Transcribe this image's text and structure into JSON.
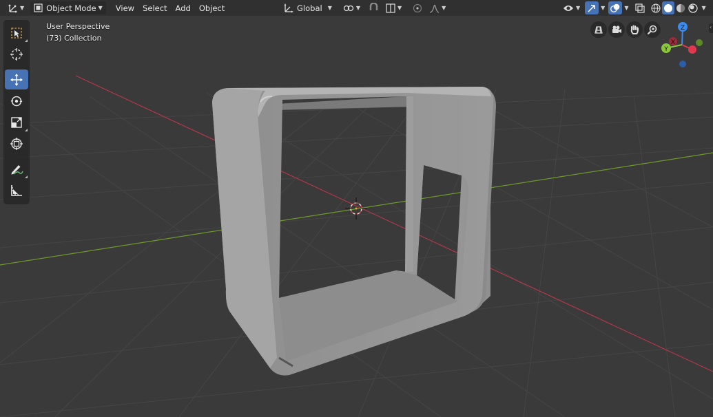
{
  "header": {
    "editor_type_icon": "axis-editor-icon",
    "mode_label": "Object Mode",
    "menus": [
      "View",
      "Select",
      "Add",
      "Object"
    ],
    "transform_orientation": "Global",
    "pivot_icon": "pivot-icon",
    "snap_icon": "magnet-icon",
    "proportional_icon": "falloff-curve-icon",
    "shading": [
      "wireframe",
      "solid",
      "material-preview",
      "rendered"
    ],
    "active_shading": "solid"
  },
  "toolbar": {
    "tools": [
      {
        "name": "select-box",
        "icon": "select-box-icon",
        "active": false
      },
      {
        "name": "cursor",
        "icon": "cursor-icon",
        "active": false
      },
      {
        "name": "move",
        "icon": "move-icon",
        "active": true
      },
      {
        "name": "rotate",
        "icon": "rotate-icon",
        "active": false
      },
      {
        "name": "scale",
        "icon": "scale-icon",
        "active": false
      },
      {
        "name": "transform",
        "icon": "transform-icon",
        "active": false
      },
      {
        "name": "annotate",
        "icon": "annotate-icon",
        "active": false
      },
      {
        "name": "measure",
        "icon": "measure-icon",
        "active": false
      }
    ]
  },
  "viewport": {
    "view_name": "User Perspective",
    "collection_info": "(73) Collection",
    "background_color": "#3a3a3a",
    "grid_color": "#4a4a4a",
    "x_axis_color": "#b0384a",
    "y_axis_color": "#6f9a2b"
  },
  "navigation": {
    "buttons": [
      "grid-view-icon",
      "camera-icon",
      "hand-pan-icon",
      "zoom-icon"
    ],
    "gizmo": {
      "x_label": "X",
      "y_label": "Y",
      "z_label": "Z",
      "x_color": "#e0384f",
      "y_color": "#8cc63f",
      "z_color": "#3a8cf0"
    }
  },
  "accent_color": "#4772b3"
}
